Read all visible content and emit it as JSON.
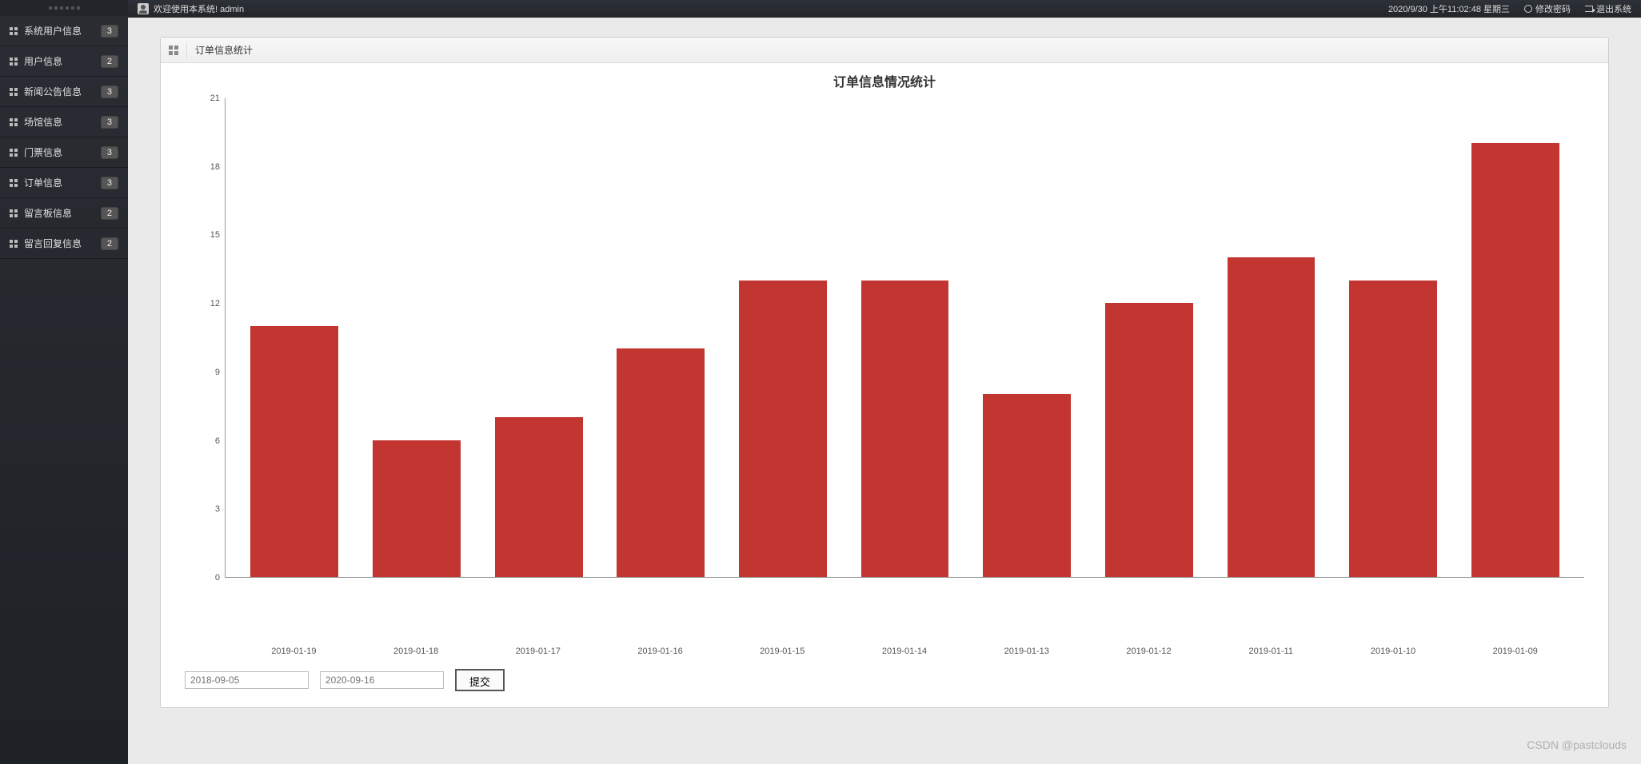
{
  "sidebar": {
    "items": [
      {
        "label": "系统用户信息",
        "badge": "3"
      },
      {
        "label": "用户信息",
        "badge": "2"
      },
      {
        "label": "新闻公告信息",
        "badge": "3"
      },
      {
        "label": "场馆信息",
        "badge": "3"
      },
      {
        "label": "门票信息",
        "badge": "3"
      },
      {
        "label": "订单信息",
        "badge": "3"
      },
      {
        "label": "留言板信息",
        "badge": "2"
      },
      {
        "label": "留言回复信息",
        "badge": "2"
      }
    ]
  },
  "topbar": {
    "welcome": "欢迎使用本系统! admin",
    "datetime": "2020/9/30 上午11:02:48 星期三",
    "change_pwd": "修改密码",
    "logout": "退出系统"
  },
  "panel": {
    "header": "订单信息统计"
  },
  "chart_data": {
    "type": "bar",
    "title": "订单信息情况统计",
    "xlabel": "",
    "ylabel": "",
    "ylim": [
      0,
      21
    ],
    "yticks": [
      0,
      3,
      6,
      9,
      12,
      15,
      18,
      21
    ],
    "categories": [
      "2019-01-19",
      "2019-01-18",
      "2019-01-17",
      "2019-01-16",
      "2019-01-15",
      "2019-01-14",
      "2019-01-13",
      "2019-01-12",
      "2019-01-11",
      "2019-01-10",
      "2019-01-09"
    ],
    "values": [
      11,
      6,
      7,
      10,
      13,
      13,
      8,
      12,
      14,
      13,
      19
    ],
    "bar_color": "#c23531"
  },
  "form": {
    "start_placeholder": "2018-09-05",
    "end_placeholder": "2020-09-16",
    "submit_label": "提交"
  },
  "watermark": "CSDN @pastclouds"
}
